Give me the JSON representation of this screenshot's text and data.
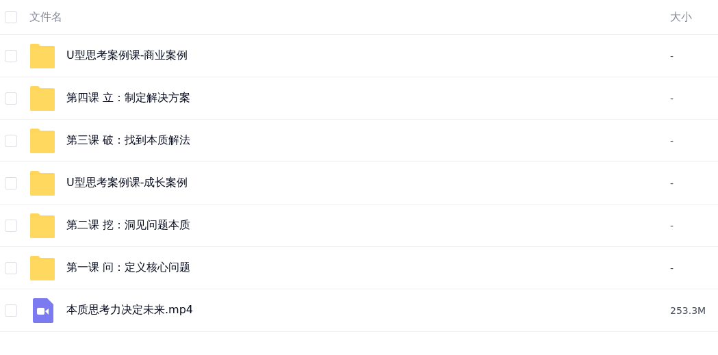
{
  "header": {
    "checked": false,
    "name_label": "文件名",
    "size_label": "大小"
  },
  "rows": [
    {
      "kind": "folder",
      "name": "U型思考案例课-商业案例",
      "size": "-",
      "checked": false
    },
    {
      "kind": "folder",
      "name": "第四课 立：制定解决方案",
      "size": "-",
      "checked": false
    },
    {
      "kind": "folder",
      "name": "第三课 破：找到本质解法",
      "size": "-",
      "checked": false
    },
    {
      "kind": "folder",
      "name": "U型思考案例课-成长案例",
      "size": "-",
      "checked": false
    },
    {
      "kind": "folder",
      "name": "第二课 挖：洞见问题本质",
      "size": "-",
      "checked": false
    },
    {
      "kind": "folder",
      "name": "第一课 问：定义核心问题",
      "size": "-",
      "checked": false
    },
    {
      "kind": "video",
      "name": "本质思考力决定未来.mp4",
      "size": "253.3M",
      "checked": false
    }
  ]
}
